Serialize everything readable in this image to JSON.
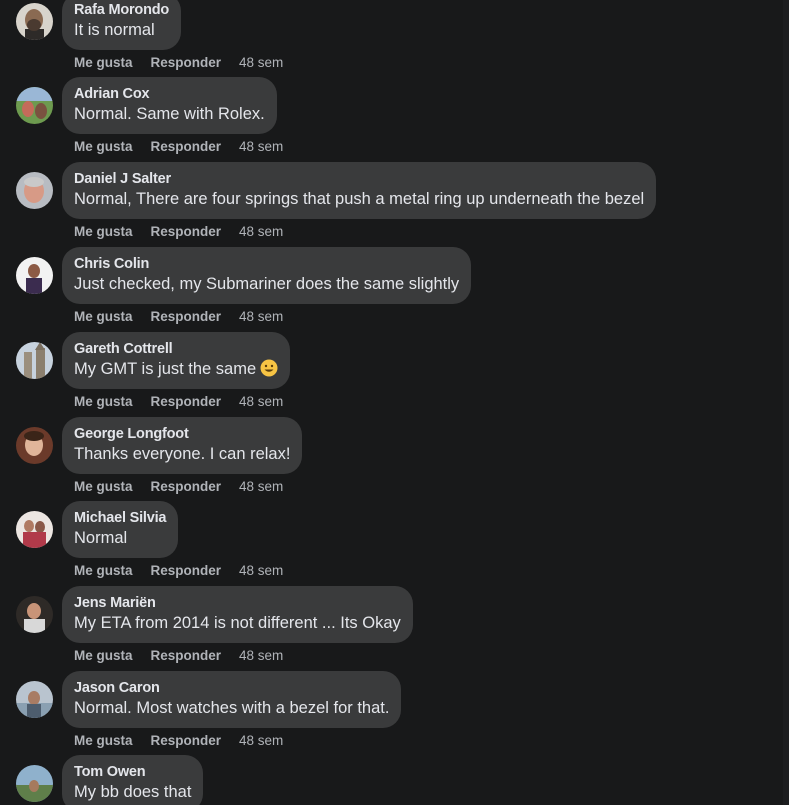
{
  "labels": {
    "like": "Me gusta",
    "reply": "Responder"
  },
  "colors": {
    "background": "#18191a",
    "bubble": "#3a3b3c",
    "text": "#e4e6eb",
    "meta": "#b0b3b8"
  },
  "comments": [
    {
      "author": "Rafa Morondo",
      "text": "It is normal",
      "time": "48 sem"
    },
    {
      "author": "Adrian Cox",
      "text": "Normal. Same with Rolex.",
      "time": "48 sem"
    },
    {
      "author": "Daniel J Salter",
      "text": "Normal, There are four springs that push a metal ring up underneath the bezel",
      "time": "48 sem"
    },
    {
      "author": "Chris Colin",
      "text": "Just checked, my Submariner does the same slightly",
      "time": "48 sem"
    },
    {
      "author": "Gareth Cottrell",
      "text": "My GMT is just the same",
      "emoji": "smiling-face-icon",
      "time": "48 sem"
    },
    {
      "author": "George Longfoot",
      "text": "Thanks everyone. I can relax!",
      "time": "48 sem"
    },
    {
      "author": "Michael Silvia",
      "text": "Normal",
      "time": "48 sem"
    },
    {
      "author": "Jens Mariën",
      "text": "My ETA from 2014 is not different ... Its Okay",
      "time": "48 sem"
    },
    {
      "author": "Jason Caron",
      "text": "Normal. Most watches with a bezel for that.",
      "time": "48 sem"
    },
    {
      "author": "Tom Owen",
      "text": "My bb does that",
      "time": ""
    }
  ]
}
